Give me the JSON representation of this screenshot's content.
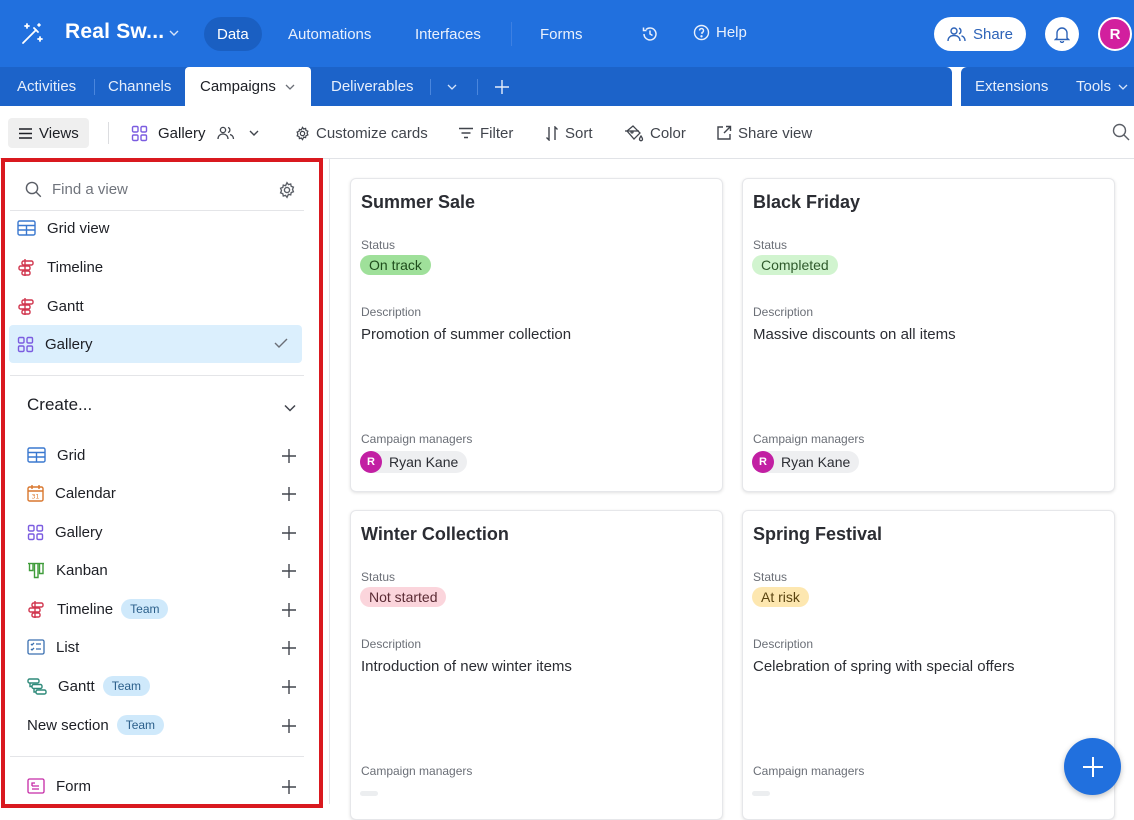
{
  "topbar": {
    "base_name": "Real Sw...",
    "nav": [
      {
        "label": "Data",
        "active": true
      },
      {
        "label": "Automations",
        "active": false
      },
      {
        "label": "Interfaces",
        "active": false
      },
      {
        "label": "Forms",
        "active": false
      }
    ],
    "help_label": "Help",
    "share_label": "Share",
    "user_initial": "R"
  },
  "tabs": {
    "items": [
      "Activities",
      "Channels",
      "Campaigns",
      "Deliverables"
    ],
    "active": "Campaigns",
    "extensions_label": "Extensions",
    "tools_label": "Tools"
  },
  "toolbar": {
    "views_label": "Views",
    "view_name": "Gallery",
    "customize_label": "Customize cards",
    "filter_label": "Filter",
    "sort_label": "Sort",
    "color_label": "Color",
    "share_view_label": "Share view"
  },
  "sidebar": {
    "find_placeholder": "Find a view",
    "views": [
      {
        "label": "Grid view",
        "icon": "grid-icon"
      },
      {
        "label": "Timeline",
        "icon": "timeline-icon"
      },
      {
        "label": "Gantt",
        "icon": "timeline-icon"
      },
      {
        "label": "Gallery",
        "icon": "gallery-icon",
        "selected": true
      }
    ],
    "create_label": "Create...",
    "create_items": [
      {
        "label": "Grid",
        "icon": "grid-icon"
      },
      {
        "label": "Calendar",
        "icon": "calendar-icon"
      },
      {
        "label": "Gallery",
        "icon": "gallery-icon"
      },
      {
        "label": "Kanban",
        "icon": "kanban-icon"
      },
      {
        "label": "Timeline",
        "icon": "timeline-icon",
        "badge": "Team"
      },
      {
        "label": "List",
        "icon": "list-icon"
      },
      {
        "label": "Gantt",
        "icon": "gantt-icon",
        "badge": "Team"
      },
      {
        "label": "New section",
        "badge": "Team"
      },
      {
        "label": "Form",
        "icon": "form-icon"
      }
    ]
  },
  "gallery": {
    "field_labels": {
      "status": "Status",
      "description": "Description",
      "managers": "Campaign managers"
    },
    "cards": [
      {
        "title": "Summer Sale",
        "status": "On track",
        "status_bg": "#9fe09a",
        "status_fg": "#1f4d1c",
        "description": "Promotion of summer collection",
        "manager": "Ryan Kane",
        "manager_initial": "R"
      },
      {
        "title": "Black Friday",
        "status": "Completed",
        "status_bg": "#d1f4cf",
        "status_fg": "#2f5a2c",
        "description": "Massive discounts on all items",
        "manager": "Ryan Kane",
        "manager_initial": "R"
      },
      {
        "title": "Winter Collection",
        "status": "Not started",
        "status_bg": "#fbd5dc",
        "status_fg": "#5a2a33",
        "description": "Introduction of new winter items",
        "manager": null
      },
      {
        "title": "Spring Festival",
        "status": "At risk",
        "status_bg": "#fde7b0",
        "status_fg": "#5a4410",
        "description": "Celebration of spring with special offers",
        "manager": null
      }
    ]
  },
  "colors": {
    "brand": "#2170de",
    "tabbar": "#1c63c9",
    "highlight_frame": "#d9191f"
  }
}
